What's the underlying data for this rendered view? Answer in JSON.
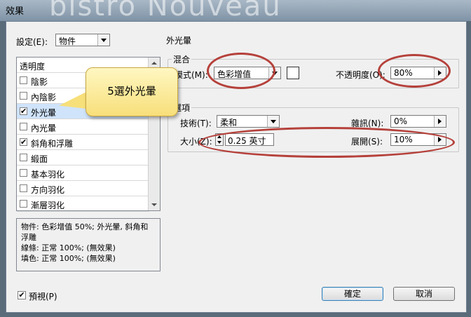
{
  "window": {
    "title": "效果",
    "background_text": "bistro Nouveau"
  },
  "settings": {
    "label": "設定(E):",
    "value": "物件"
  },
  "effects_list": {
    "items": [
      {
        "label": "透明度",
        "checkbox": false
      },
      {
        "label": "陰影",
        "checkbox": true,
        "checked": false
      },
      {
        "label": "內陰影",
        "checkbox": true,
        "checked": false
      },
      {
        "label": "外光暈",
        "checkbox": true,
        "checked": true,
        "selected": true
      },
      {
        "label": "內光暈",
        "checkbox": true,
        "checked": false
      },
      {
        "label": "斜角和浮雕",
        "checkbox": true,
        "checked": true
      },
      {
        "label": "緞面",
        "checkbox": true,
        "checked": false
      },
      {
        "label": "基本羽化",
        "checkbox": true,
        "checked": false
      },
      {
        "label": "方向羽化",
        "checkbox": true,
        "checked": false
      },
      {
        "label": "漸層羽化",
        "checkbox": true,
        "checked": false
      }
    ]
  },
  "summary": {
    "line1": "物件: 色彩增值 50%; 外光暈, 斜角和",
    "line2": "浮雕",
    "line3": "線條: 正常 100%; (無效果)",
    "line4": "填色: 正常 100%; (無效果)"
  },
  "panel": {
    "title": "外光暈",
    "blend": {
      "group_label": "混合",
      "mode_label": "模式(M):",
      "mode_value": "色彩增值",
      "opacity_label": "不透明度(O):",
      "opacity_value": "80%"
    },
    "options": {
      "group_label": "選項",
      "technique_label": "技術(T):",
      "technique_value": "柔和",
      "noise_label": "雜訊(N):",
      "noise_value": "0%",
      "size_label": "大小(Z):",
      "size_value": "0.25 英寸",
      "spread_label": "展開(S):",
      "spread_value": "10%"
    }
  },
  "preview": {
    "label": "預視(P)",
    "checked": true
  },
  "buttons": {
    "ok": "確定",
    "cancel": "取消"
  },
  "callout": {
    "text": "5選外光暈"
  },
  "colors": {
    "highlight_ring": "#b5413b",
    "callout_fill": "#f7df7a",
    "selection": "#cfe3fa"
  },
  "icons": {
    "check": "✔"
  }
}
